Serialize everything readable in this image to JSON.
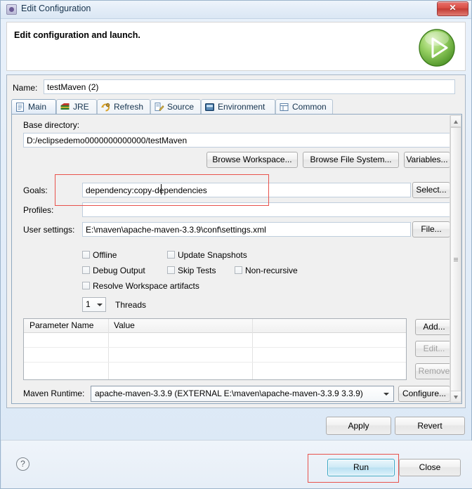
{
  "window": {
    "title": "Edit Configuration",
    "title_icon": "eclipse-config-icon",
    "close_glyph": "✕"
  },
  "header": {
    "title": "Edit configuration and launch.",
    "icon": "run-play-icon"
  },
  "name_row": {
    "label": "Name:",
    "value": "testMaven (2)"
  },
  "tabs": [
    {
      "label": "Main",
      "icon": "document-icon",
      "active": true
    },
    {
      "label": "JRE",
      "icon": "jre-icon",
      "active": false
    },
    {
      "label": "Refresh",
      "icon": "refresh-icon",
      "active": false
    },
    {
      "label": "Source",
      "icon": "source-icon",
      "active": false
    },
    {
      "label": "Environment",
      "icon": "environment-icon",
      "active": false
    },
    {
      "label": "Common",
      "icon": "common-icon",
      "active": false
    }
  ],
  "main_tab": {
    "base_directory": {
      "label": "Base directory:",
      "value": "D:/eclipsedemo0000000000000/testMaven"
    },
    "dir_buttons": [
      {
        "label": "Browse Workspace..."
      },
      {
        "label": "Browse File System..."
      },
      {
        "label": "Variables..."
      }
    ],
    "goals": {
      "label": "Goals:",
      "value": "dependency:copy-dependencies",
      "button": "Select...",
      "highlighted": true
    },
    "profiles": {
      "label": "Profiles:",
      "value": ""
    },
    "user_settings": {
      "label": "User settings:",
      "value": "E:\\maven\\apache-maven-3.3.9\\conf\\settings.xml",
      "button": "File..."
    },
    "checkboxes": [
      {
        "label": "Offline",
        "checked": false
      },
      {
        "label": "Update Snapshots",
        "checked": false
      },
      {
        "label": "Debug Output",
        "checked": false
      },
      {
        "label": "Skip Tests",
        "checked": false
      },
      {
        "label": "Non-recursive",
        "checked": false
      },
      {
        "label": "Resolve Workspace artifacts",
        "checked": false
      }
    ],
    "threads": {
      "value": "1",
      "label": "Threads"
    },
    "parameters_table": {
      "columns": [
        "Parameter Name",
        "Value"
      ],
      "rows": []
    },
    "table_buttons": [
      {
        "label": "Add...",
        "enabled": true
      },
      {
        "label": "Edit...",
        "enabled": false
      },
      {
        "label": "Remove",
        "enabled": false
      }
    ],
    "maven_runtime": {
      "label": "Maven Runtime:",
      "value": "apache-maven-3.3.9 (EXTERNAL E:\\maven\\apache-maven-3.3.9 3.3.9)",
      "button": "Configure..."
    }
  },
  "footer": {
    "apply": "Apply",
    "revert": "Revert",
    "help_glyph": "?",
    "run": "Run",
    "close": "Close",
    "run_highlighted": true
  },
  "colors": {
    "accent_blue": "#3ba7c4",
    "annotation_red": "#e8524c",
    "title_text": "#17334d",
    "panel_bg": "#f0f0f0"
  }
}
